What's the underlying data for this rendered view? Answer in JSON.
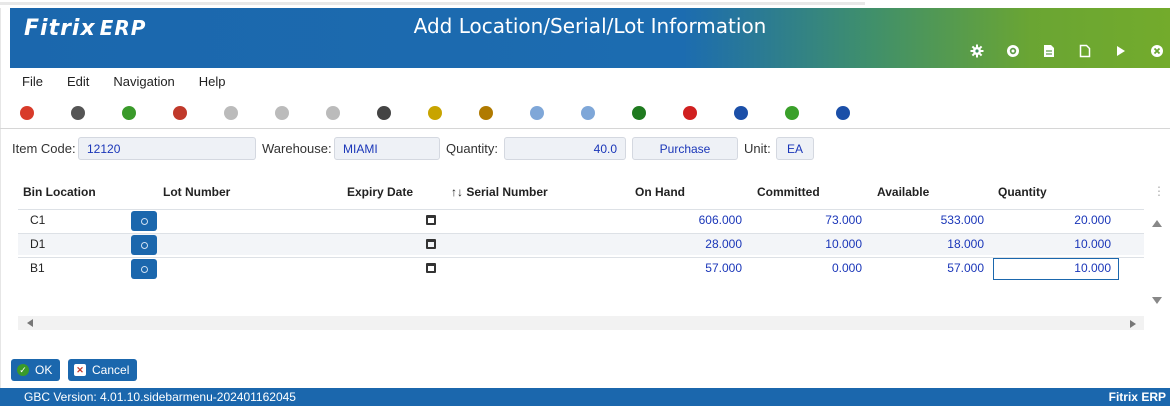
{
  "app": {
    "logo": "Fitrix",
    "logo_suffix": "ERP",
    "title": "Add Location/Serial/Lot Information"
  },
  "header_icons": [
    "gear-icon",
    "target-icon",
    "document-icon",
    "new-document-icon",
    "play-icon",
    "close-icon"
  ],
  "menu": [
    "File",
    "Edit",
    "Navigation",
    "Help"
  ],
  "toolbar": [
    {
      "name": "exit-icon",
      "color": "#d83b2a"
    },
    {
      "name": "copy-icon",
      "color": "#555555"
    },
    {
      "name": "accept-icon",
      "color": "#3a9a2a"
    },
    {
      "name": "cancel-icon",
      "color": "#c0392b"
    },
    {
      "name": "page-icon",
      "color": "#bbbbbb"
    },
    {
      "name": "pages-icon",
      "color": "#bbbbbb"
    },
    {
      "name": "printer-icon",
      "color": "#bbbbbb"
    },
    {
      "name": "find-icon",
      "color": "#444444"
    },
    {
      "name": "user-lookup-icon",
      "color": "#c8a400"
    },
    {
      "name": "badge-icon",
      "color": "#b07a00"
    },
    {
      "name": "scroll-down-icon",
      "color": "#7fa7d8"
    },
    {
      "name": "scroll-up-icon",
      "color": "#7fa7d8"
    },
    {
      "name": "insert-row-icon",
      "color": "#1f7a1f"
    },
    {
      "name": "delete-row-icon",
      "color": "#d02020"
    },
    {
      "name": "split-icon",
      "color": "#1b4fa8"
    },
    {
      "name": "chat-icon",
      "color": "#3aa02a"
    },
    {
      "name": "help-icon",
      "color": "#1b4fa8"
    }
  ],
  "fields": {
    "item_code_label": "Item Code:",
    "item_code": "12120",
    "warehouse_label": "Warehouse:",
    "warehouse": "MIAMI",
    "quantity_label": "Quantity:",
    "quantity": "40.0",
    "purchase": "Purchase",
    "unit_label": "Unit:",
    "unit": "EA"
  },
  "grid": {
    "columns": [
      "Bin Location",
      "Lot Number",
      "Expiry Date",
      "↑↓ Serial Number",
      "On Hand",
      "Committed",
      "Available",
      "Quantity"
    ],
    "rows": [
      {
        "bin": "C1",
        "on_hand": "606.000",
        "committed": "73.000",
        "available": "533.000",
        "quantity": "20.000"
      },
      {
        "bin": "D1",
        "on_hand": "28.000",
        "committed": "10.000",
        "available": "18.000",
        "quantity": "10.000"
      },
      {
        "bin": "B1",
        "on_hand": "57.000",
        "committed": "0.000",
        "available": "57.000",
        "quantity": "10.000"
      }
    ]
  },
  "buttons": {
    "ok": "OK",
    "cancel": "Cancel"
  },
  "footer": {
    "version": "GBC Version: 4.01.10.sidebarmenu-202401162045",
    "brand": "Fitrix ERP"
  }
}
